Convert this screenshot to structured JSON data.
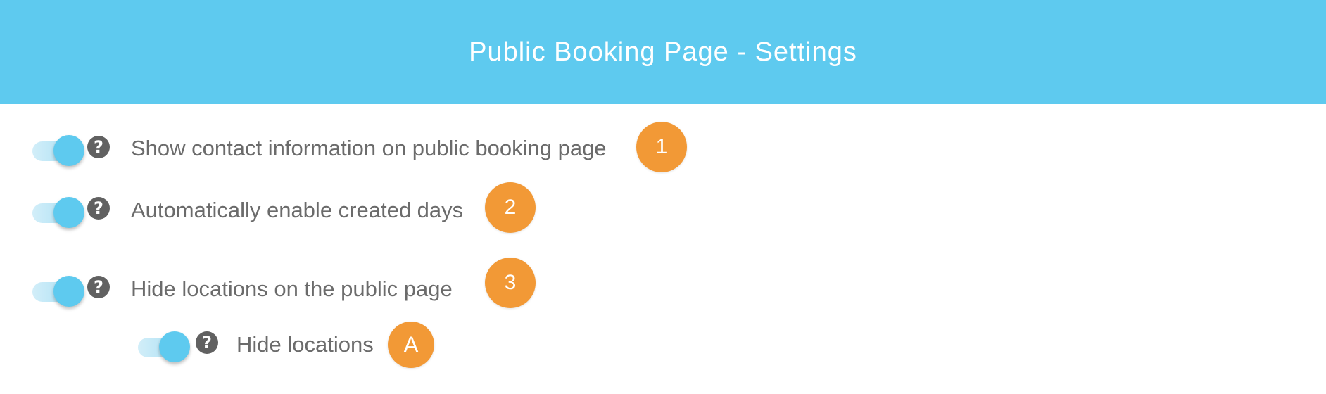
{
  "header": {
    "title": "Public Booking Page - Settings"
  },
  "help_icon_glyph": "?",
  "settings": [
    {
      "label": "Show contact information on public booking page",
      "enabled": true,
      "badge": "1"
    },
    {
      "label": "Automatically enable created days",
      "enabled": true,
      "badge": "2"
    },
    {
      "label": "Hide locations on the public page",
      "enabled": true,
      "badge": "3"
    },
    {
      "label": "Hide locations",
      "enabled": true,
      "badge": "A"
    }
  ],
  "colors": {
    "header_bg": "#5ecaef",
    "toggle_on": "#5ecaef",
    "badge_bg": "#f29936",
    "label_text": "#6b6b6b",
    "help_icon": "#616161"
  }
}
